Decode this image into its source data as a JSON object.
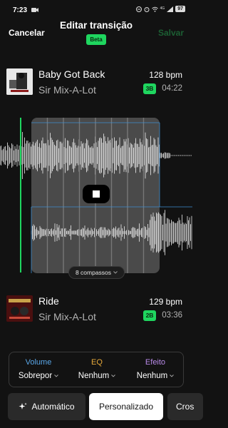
{
  "status_bar": {
    "time": "7:23",
    "network": "4G",
    "battery": "97",
    "icons": [
      "camera-icon",
      "do-not-disturb-icon",
      "alarm-icon",
      "wifi-icon",
      "signal-icon",
      "battery-icon"
    ]
  },
  "header": {
    "cancel_label": "Cancelar",
    "title": "Editar transição",
    "badge": "Beta",
    "save_label": "Salvar"
  },
  "track1": {
    "title": "Baby Got Back",
    "artist": "Sir Mix-A-Lot",
    "bpm": "128 bpm",
    "key": "3B",
    "duration": "04:22"
  },
  "track2": {
    "title": "Ride",
    "artist": "Sir Mix-A-Lot",
    "bpm": "129 bpm",
    "key": "2B",
    "duration": "03:36"
  },
  "transition": {
    "length_label": "8 compassos"
  },
  "controls": [
    {
      "label": "Volume",
      "value": "Sobrepor",
      "color": "#5aa7e8"
    },
    {
      "label": "EQ",
      "value": "Nenhum",
      "color": "#e6a93a"
    },
    {
      "label": "Efeito",
      "value": "Nenhum",
      "color": "#b88ae8"
    }
  ],
  "modes": {
    "auto": "Automático",
    "custom": "Personalizado",
    "third": "Cros"
  },
  "colors": {
    "accent": "#1fd65f",
    "background": "#121212",
    "save_disabled": "#1c5f33"
  }
}
